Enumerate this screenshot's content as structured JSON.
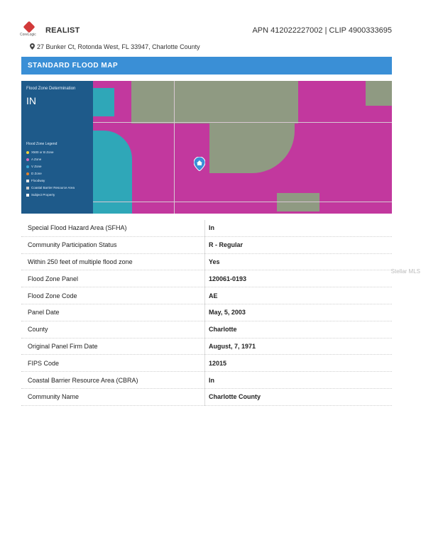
{
  "header": {
    "logo_text": "CoreLogic",
    "brand": "REALIST",
    "apn_clip": "APN 412022227002 | CLIP 4900333695"
  },
  "address": "27 Bunker Ct, Rotonda West, FL 33947, Charlotte County",
  "banner": "STANDARD FLOOD MAP",
  "map": {
    "fzd_label": "Flood Zone Determination",
    "fzd_value": "IN",
    "legend_title": "Flood Zone Legend",
    "legend": [
      {
        "label": "X500 or B Zone",
        "color": "#f2d23a"
      },
      {
        "label": "A Zone",
        "color": "#d26fbf"
      },
      {
        "label": "V Zone",
        "color": "#39a9d6"
      },
      {
        "label": "D Zone",
        "color": "#e0822c"
      },
      {
        "label": "Floodway",
        "color": "#e6e6e6"
      },
      {
        "label": "Coastal Barrier Resource Area",
        "color": "#cccccc"
      },
      {
        "label": "Subject Property",
        "color": "#ffffff"
      }
    ]
  },
  "rows": [
    {
      "label": "Special Flood Hazard Area (SFHA)",
      "value": "In"
    },
    {
      "label": "Community Participation Status",
      "value": "R - Regular"
    },
    {
      "label": "Within 250 feet of multiple flood zone",
      "value": "Yes"
    },
    {
      "label": "Flood Zone Panel",
      "value": "120061-0193"
    },
    {
      "label": "Flood Zone Code",
      "value": "AE"
    },
    {
      "label": "Panel Date",
      "value": "May, 5, 2003"
    },
    {
      "label": "County",
      "value": "Charlotte"
    },
    {
      "label": "Original Panel Firm Date",
      "value": "August, 7, 1971"
    },
    {
      "label": "FIPS Code",
      "value": "12015"
    },
    {
      "label": "Coastal Barrier Resource Area (CBRA)",
      "value": "In"
    },
    {
      "label": "Community Name",
      "value": "Charlotte County"
    }
  ],
  "side_text": "Stellar MLS"
}
